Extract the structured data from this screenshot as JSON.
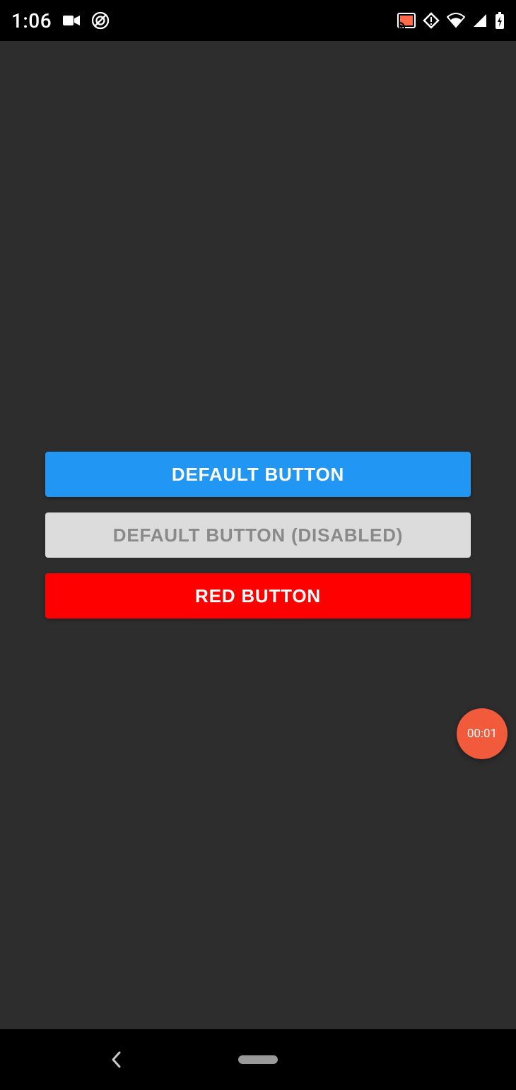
{
  "status": {
    "time": "1:06"
  },
  "buttons": {
    "default": "DEFAULT BUTTON",
    "disabled": "DEFAULT BUTTON (DISABLED)",
    "red": "RED BUTTON"
  },
  "recording": {
    "timer": "00:01"
  },
  "colors": {
    "app_bg": "#2d2d2d",
    "primary": "#2196f3",
    "disabled_bg": "#dcdcdc",
    "disabled_fg": "#8a8a8a",
    "red": "#ff0000",
    "rec_bubble": "#f15a3a"
  }
}
